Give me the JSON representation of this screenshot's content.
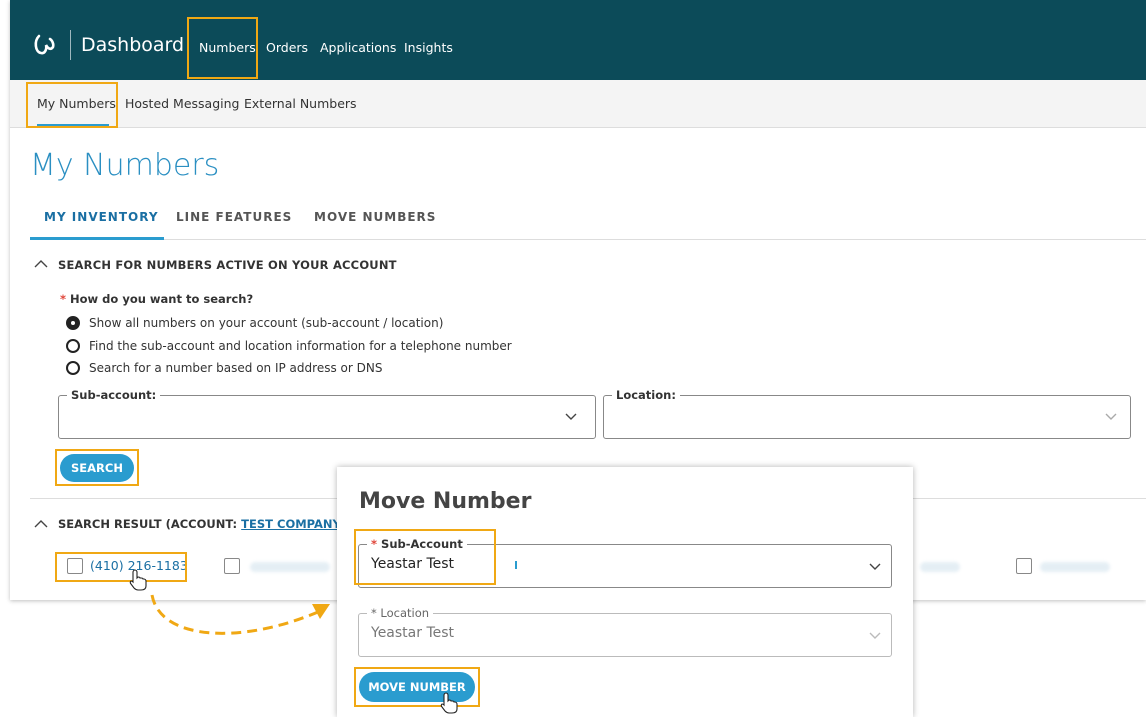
{
  "header": {
    "brand": "Dashboard",
    "nav": [
      "Numbers",
      "Orders",
      "Applications",
      "Insights"
    ]
  },
  "subnav": [
    "My Numbers",
    "Hosted Messaging",
    "External Numbers"
  ],
  "page_title": "My Numbers",
  "tabs": [
    "MY INVENTORY",
    "LINE FEATURES",
    "MOVE NUMBERS"
  ],
  "search_section": {
    "title": "SEARCH FOR NUMBERS ACTIVE ON YOUR ACCOUNT",
    "required_mark": "*",
    "question": "How do you want to search?",
    "options": [
      "Show all numbers on your account (sub-account / location)",
      "Find the sub-account and location information for a telephone number",
      "Search for a number based on IP address or DNS"
    ],
    "sub_account_label": "Sub-account:",
    "location_label": "Location:",
    "search_button": "SEARCH"
  },
  "result_section": {
    "title_prefix": "SEARCH RESULT (ACCOUNT: ",
    "account": "TEST COMPANY",
    "numbers": [
      "(410) 216-1183"
    ]
  },
  "modal": {
    "title": "Move Number",
    "sub_account_label": "Sub-Account",
    "sub_account_value": "Yeastar Test",
    "location_label": "Location",
    "location_value": "Yeastar Test",
    "button": "MOVE NUMBER"
  },
  "colors": {
    "header_bg": "#0c4b59",
    "accent": "#2a9ccf",
    "highlight": "#f0a814"
  }
}
